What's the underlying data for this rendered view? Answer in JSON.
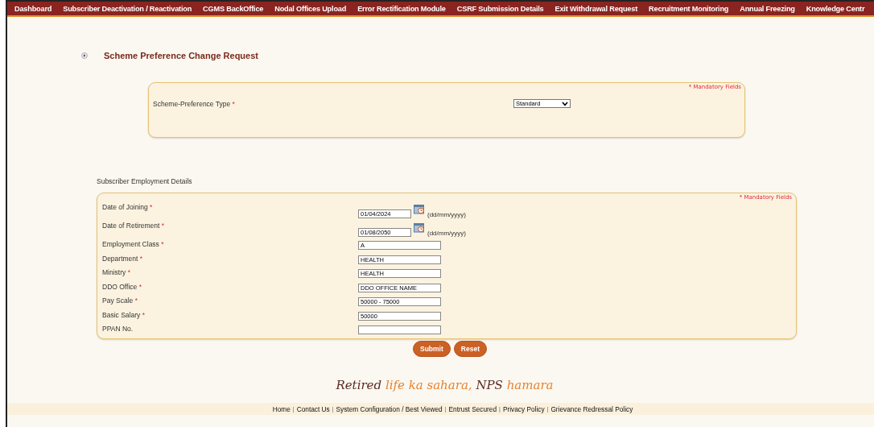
{
  "nav": [
    {
      "label": "Dashboard"
    },
    {
      "label": "Subscriber Deactivation / Reactivation"
    },
    {
      "label": "CGMS BackOffice"
    },
    {
      "label": "Nodal Offices Upload"
    },
    {
      "label": "Error Rectification Module"
    },
    {
      "label": "CSRF Submission Details"
    },
    {
      "label": "Exit Withdrawal Request"
    },
    {
      "label": "Recruitment Monitoring"
    },
    {
      "label": "Annual Freezing"
    },
    {
      "label": "Knowledge Centr"
    }
  ],
  "page_title": "Scheme Preference Change Request",
  "preference_panel": {
    "mandatory_note": {
      "mark": "*",
      "text": "Mandatory Fields"
    },
    "field": {
      "label": "Scheme-Preference Type",
      "mark": "*",
      "value": "Standard"
    }
  },
  "employment_section": {
    "title": "Subscriber Employment Details",
    "mandatory_note": {
      "mark": "*",
      "text": "Mandatory Fields"
    },
    "fields": [
      {
        "kind": "date",
        "label": "Date of Joining",
        "mark": "*",
        "value": "01/04/2024",
        "hint": "(dd/mm/yyyy)"
      },
      {
        "kind": "date",
        "label": "Date of Retirement",
        "mark": "*",
        "value": "01/08/2050",
        "hint": "(dd/mm/yyyy)"
      },
      {
        "kind": "text",
        "label": "Employment Class",
        "mark": "*",
        "value": "A"
      },
      {
        "kind": "text",
        "label": "Department",
        "mark": "*",
        "value": "HEALTH"
      },
      {
        "kind": "text",
        "label": "Ministry",
        "mark": "*",
        "value": "HEALTH"
      },
      {
        "kind": "text",
        "label": "DDO Office",
        "mark": "*",
        "value": "DDO OFFICE NAME"
      },
      {
        "kind": "text",
        "label": "Pay Scale",
        "mark": "*",
        "value": "50000 - 75000"
      },
      {
        "kind": "text",
        "label": "Basic Salary",
        "mark": "*",
        "value": "50000"
      },
      {
        "kind": "text",
        "label": "PPAN No."
      }
    ],
    "buttons": [
      "Submit",
      "Reset"
    ]
  },
  "tagline": [
    {
      "text": "Retired",
      "color": "#5a2a22"
    },
    {
      "text": "life ka sahara,",
      "color": "#e8822e"
    },
    {
      "text": "NPS",
      "color": "#5a2a22"
    },
    {
      "text": "hamara",
      "color": "#e8822e"
    }
  ],
  "footer_links": [
    {
      "label": "Home"
    },
    {
      "label": "Contact Us",
      "separator": "|"
    },
    {
      "label": "System Configuration / Best Viewed",
      "separator": "|"
    },
    {
      "label": "Entrust Secured",
      "separator": "|"
    },
    {
      "label": "Privacy Policy",
      "separator": "|"
    },
    {
      "label": "Grievance Redressal Policy",
      "separator": "|"
    }
  ]
}
